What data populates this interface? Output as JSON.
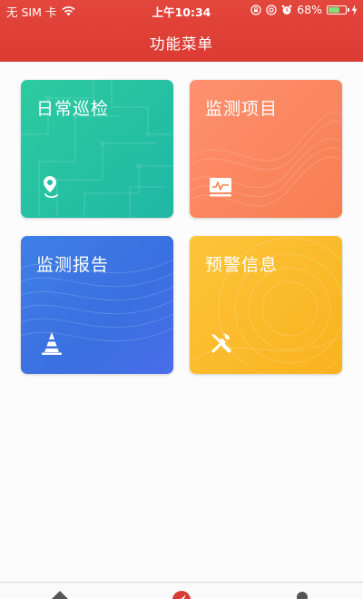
{
  "status_bar": {
    "carrier": "无 SIM 卡",
    "time": "上午10:34",
    "battery_percent": "68%",
    "battery_level": 0.68,
    "icons": [
      "wifi-icon",
      "lock-rotation-icon",
      "at-icon",
      "alarm-icon",
      "battery-icon",
      "charging-icon"
    ]
  },
  "header": {
    "title": "功能菜单",
    "color": "#e0413a"
  },
  "menu": {
    "items": [
      {
        "label": "日常巡检",
        "icon": "location-pin-icon",
        "color": "#26c2a3"
      },
      {
        "label": "监测项目",
        "icon": "monitor-chart-icon",
        "color": "#fa8460"
      },
      {
        "label": "监测报告",
        "icon": "traffic-cone-icon",
        "color": "#3c77e4"
      },
      {
        "label": "预警信息",
        "icon": "tools-icon",
        "color": "#fbbb2c"
      }
    ]
  },
  "tabbar": {
    "tabs": [
      {
        "icon": "home-icon",
        "color": "#555555"
      },
      {
        "icon": "compass-icon",
        "color": "#d93a35"
      },
      {
        "icon": "user-icon",
        "color": "#555555"
      }
    ]
  }
}
